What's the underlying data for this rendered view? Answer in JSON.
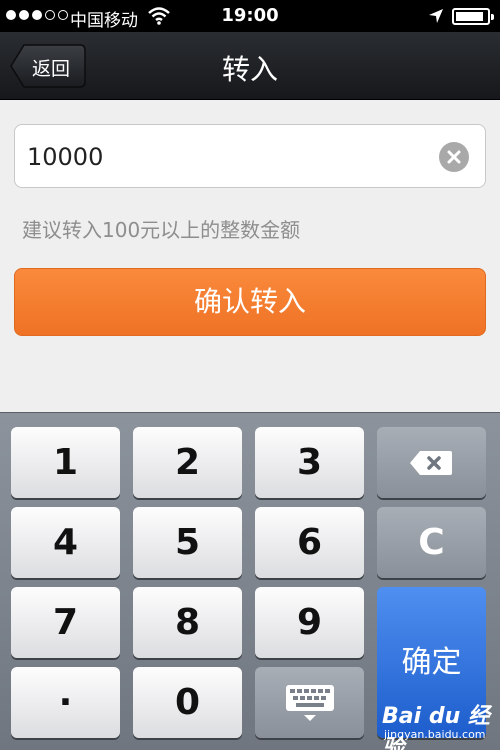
{
  "status_bar": {
    "carrier": "中国移动",
    "time": "19:00",
    "signal_icon": "signal-dots-icon",
    "wifi_icon": "wifi-icon",
    "location_icon": "location-arrow-icon",
    "battery_icon": "battery-icon",
    "battery_level": 0.9
  },
  "navbar": {
    "back_label": "返回",
    "title": "转入"
  },
  "amount_input": {
    "value": "10000",
    "clear_icon": "clear-x-icon"
  },
  "hint": "建议转入100元以上的整数金额",
  "confirm_button": "确认转入",
  "keypad": {
    "digits": [
      "1",
      "2",
      "3",
      "4",
      "5",
      "6",
      "7",
      "8",
      "9",
      "0"
    ],
    "dot": "·",
    "clear": "C",
    "confirm": "确定",
    "backspace_icon": "backspace-icon",
    "hide_keyboard_icon": "hide-keyboard-icon"
  },
  "watermark": {
    "brand": "Bai du 经验",
    "url": "jingyan.baidu.com"
  },
  "colors": {
    "accent_orange": "#f47b2c",
    "confirm_blue": "#2d6fdd",
    "navbar": "#1f2226"
  }
}
